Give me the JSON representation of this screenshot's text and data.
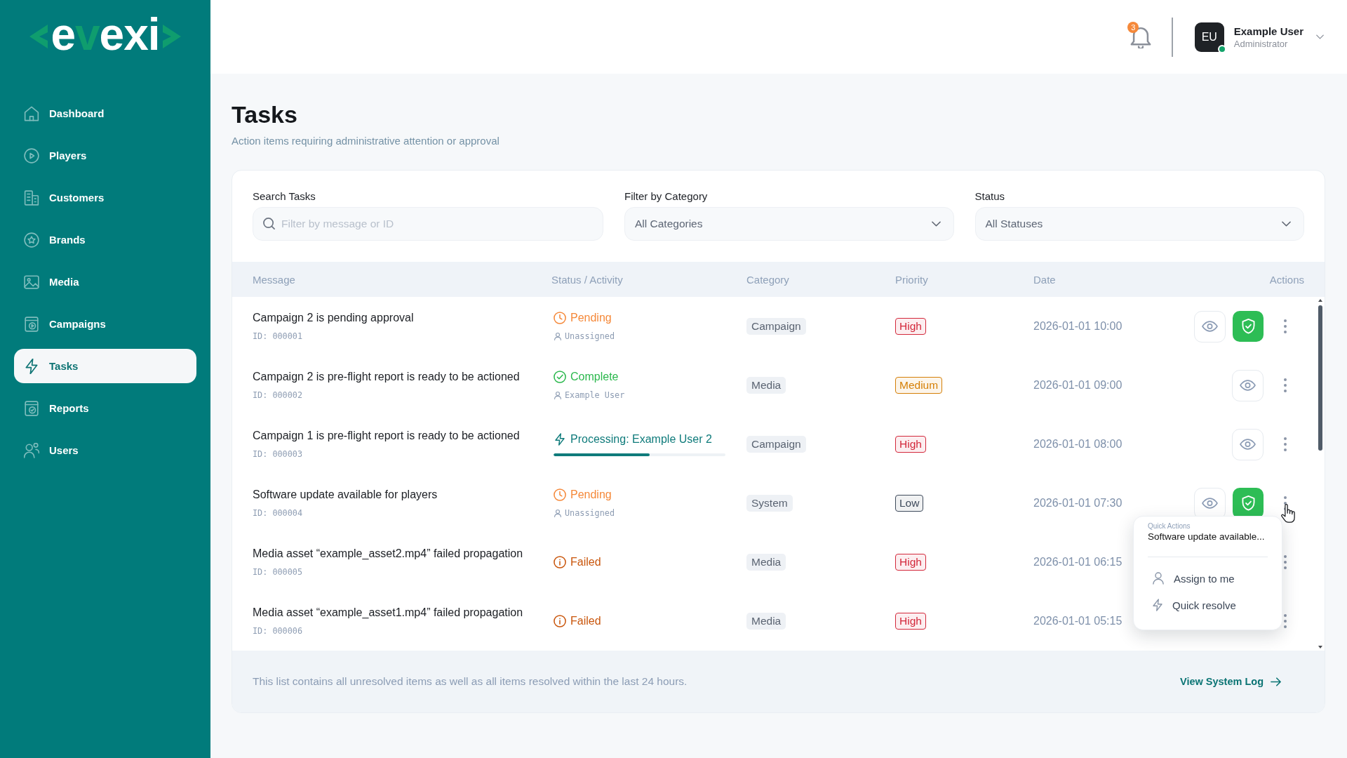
{
  "sidebar": {
    "logo": {
      "parts": [
        {
          "text": "e",
          "color": "#ffffff"
        },
        {
          "text": "v",
          "color": "#0f9d6e"
        },
        {
          "text": "exi",
          "color": "#ffffff"
        }
      ]
    },
    "items": [
      {
        "label": "Dashboard",
        "selected": false
      },
      {
        "label": "Players",
        "selected": false
      },
      {
        "label": "Customers",
        "selected": false
      },
      {
        "label": "Brands",
        "selected": false
      },
      {
        "label": "Media",
        "selected": false
      },
      {
        "label": "Campaigns",
        "selected": false
      },
      {
        "label": "Tasks",
        "selected": true
      },
      {
        "label": "Reports",
        "selected": false
      },
      {
        "label": "Users",
        "selected": false
      }
    ]
  },
  "header": {
    "notification_count": "3",
    "user": {
      "initials": "EU",
      "name": "Example User",
      "role": "Administrator",
      "online": true
    }
  },
  "page": {
    "title": "Tasks",
    "subtitle": "Action items requiring administrative attention or approval"
  },
  "filters": [
    {
      "kind": "search",
      "label": "Search Tasks",
      "placeholder": "Filter by message or ID"
    },
    {
      "kind": "select",
      "label": "Filter by Category",
      "value": "All Categories"
    },
    {
      "kind": "select",
      "label": "Status",
      "value": "All Statuses"
    }
  ],
  "table": {
    "columns": [
      "Message",
      "Status / Activity",
      "Category",
      "Priority",
      "Date",
      "Actions"
    ],
    "rows": [
      {
        "message": "Campaign 2 is pending approval",
        "id": "ID: 000001",
        "status": {
          "kind": "pending",
          "text": "Pending",
          "assignee": "Unassigned"
        },
        "category": "Campaign",
        "priority": {
          "text": "High",
          "color": "#d3283b"
        },
        "date": "2026-01-01 10:00",
        "actions": [
          {
            "kind": "view"
          },
          {
            "kind": "approve"
          },
          {
            "kind": "more"
          }
        ]
      },
      {
        "message": "Campaign 2 is pre-flight report is ready to be actioned",
        "id": "ID: 000002",
        "status": {
          "kind": "complete",
          "text": "Complete",
          "assignee": "Example User"
        },
        "category": "Media",
        "priority": {
          "text": "Medium",
          "color": "#d57f06"
        },
        "date": "2026-01-01 09:00",
        "actions": [
          {
            "kind": "view"
          },
          {
            "kind": "more"
          }
        ]
      },
      {
        "message": "Campaign 1 is pre-flight report is ready to be actioned",
        "id": "ID: 000003",
        "status": {
          "kind": "processing",
          "text": "Processing: Example User 2",
          "level": 0.56
        },
        "category": "Campaign",
        "priority": {
          "text": "High",
          "color": "#d3283b"
        },
        "date": "2026-01-01 08:00",
        "actions": [
          {
            "kind": "view"
          },
          {
            "kind": "more"
          }
        ]
      },
      {
        "message": "Software update available for players",
        "id": "ID: 000004",
        "status": {
          "kind": "pending",
          "text": "Pending",
          "assignee": "Unassigned"
        },
        "category": "System",
        "priority": {
          "text": "Low",
          "color": "#3e4a5b"
        },
        "date": "2026-01-01 07:30",
        "actions": [
          {
            "kind": "view"
          },
          {
            "kind": "approve"
          },
          {
            "kind": "more"
          }
        ]
      },
      {
        "message": "Media asset “example_asset2.mp4” failed propagation",
        "id": "ID: 000005",
        "status": {
          "kind": "failed",
          "text": "Failed"
        },
        "category": "Media",
        "priority": {
          "text": "High",
          "color": "#d3283b"
        },
        "date": "2026-01-01 06:15",
        "actions": [
          {
            "kind": "more"
          }
        ]
      },
      {
        "message": "Media asset “example_asset1.mp4” failed propagation",
        "id": "ID: 000006",
        "status": {
          "kind": "failed",
          "text": "Failed"
        },
        "category": "Media",
        "priority": {
          "text": "High",
          "color": "#d3283b"
        },
        "date": "2026-01-01 05:15",
        "actions": [
          {
            "kind": "more"
          }
        ]
      }
    ]
  },
  "popup": {
    "caption": "Quick Actions",
    "title": "Software update available...",
    "items": [
      {
        "label": "Assign to me"
      },
      {
        "label": "Quick resolve"
      }
    ]
  },
  "footer": {
    "note": "This list contains all unresolved items as well as all items resolved within the last 24 hours.",
    "link": "View System Log"
  }
}
